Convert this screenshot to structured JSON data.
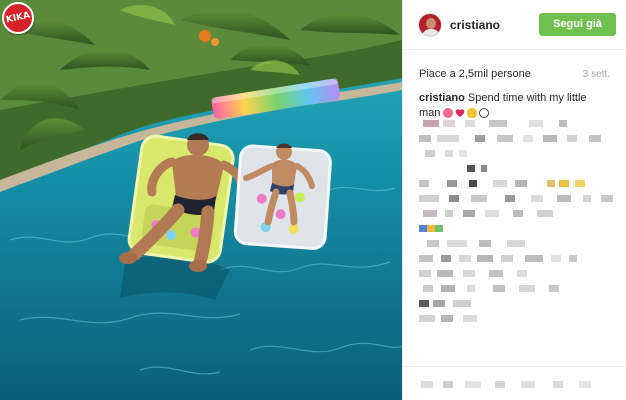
{
  "watermark": {
    "text": "KIKA"
  },
  "header": {
    "username": "cristiano",
    "follow_label": "Segui già",
    "follow_color": "#70c050"
  },
  "meta": {
    "likes": "Piace a 2,5mil persone",
    "date": "3 sett."
  },
  "caption": {
    "author": "cristiano",
    "text": "Spend time with my little man",
    "emojis": [
      "kiss-emoji",
      "heart-emoji",
      "ok-hand-emoji",
      "soccer-ball-emoji"
    ]
  },
  "colors": {
    "pool": "#1aa0b3",
    "follow": "#70c050",
    "avatar": "#b11f2b"
  }
}
